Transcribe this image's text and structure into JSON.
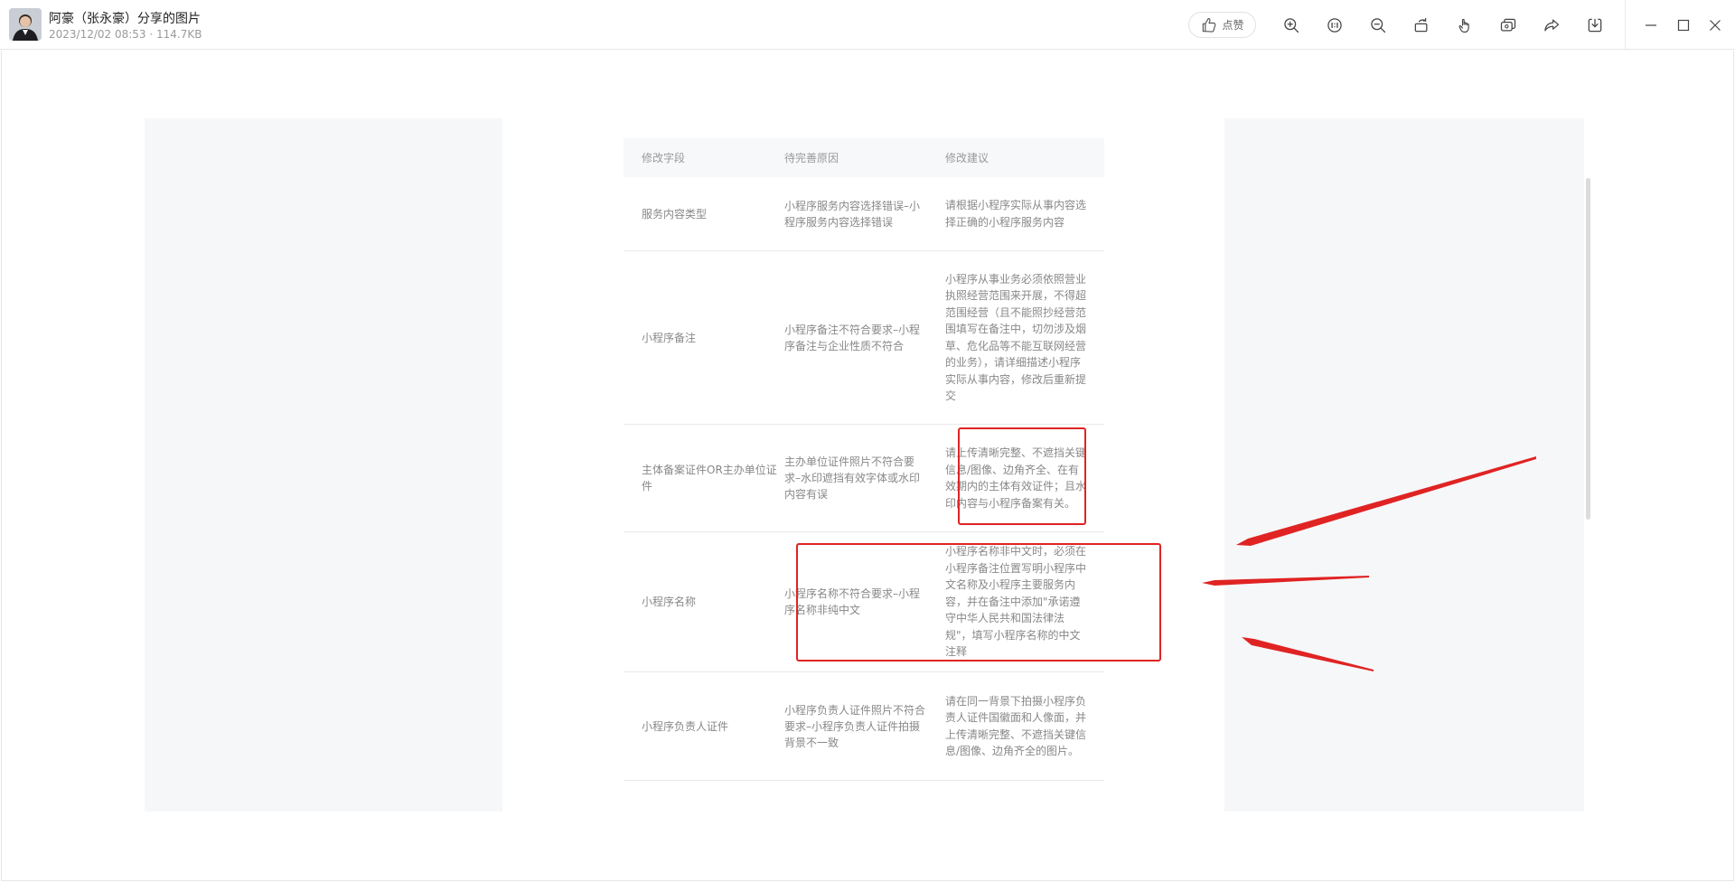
{
  "window": {
    "title": "阿豪（张永豪）分享的图片",
    "subtitle": "2023/12/02 08:53 · 114.7KB",
    "like_label": "点赞"
  },
  "toolbar": {
    "tools": [
      "zoom-in-icon",
      "actual-size-icon",
      "zoom-out-icon",
      "rotate-icon",
      "hand-icon",
      "copy-icon",
      "share-icon",
      "download-icon"
    ],
    "window_controls": [
      "minimize-icon",
      "maximize-icon",
      "close-icon"
    ]
  },
  "table": {
    "headers": [
      "修改字段",
      "待完善原因",
      "修改建议"
    ],
    "rows": [
      {
        "field": "服务内容类型",
        "reason": "小程序服务内容选择错误–小程序服务内容选择错误",
        "suggestion": "请根据小程序实际从事内容选择正确的小程序服务内容"
      },
      {
        "field": "小程序备注",
        "reason": "小程序备注不符合要求–小程序备注与企业性质不符合",
        "suggestion": "小程序从事业务必须依照营业执照经营范围来开展，不得超范围经营（且不能照抄经营范围填写在备注中，切勿涉及烟草、危化品等不能互联网经营的业务），请详细描述小程序实际从事内容，修改后重新提交"
      },
      {
        "field": "主体备案证件OR主办单位证件",
        "reason": "主办单位证件照片不符合要求–水印遮挡有效字体或水印内容有误",
        "suggestion": "请上传清晰完整、不遮挡关键信息/图像、边角齐全、在有效期内的主体有效证件；且水印内容与小程序备案有关。"
      },
      {
        "field": "小程序名称",
        "reason": "小程序名称不符合要求–小程序名称非纯中文",
        "suggestion": "小程序名称非中文时，必须在小程序备注位置写明小程序中文名称及小程序主要服务内容，并在备注中添加\"承诺遵守中华人民共和国法律法规\"，填写小程序名称的中文注释"
      },
      {
        "field": "小程序负责人证件",
        "reason": "小程序负责人证件照片不符合要求–小程序负责人证件拍摄背景不一致",
        "suggestion": "请在同一背景下拍摄小程序负责人证件国徽面和人像面，并上传清晰完整、不遮挡关键信息/图像、边角齐全的图片。"
      }
    ]
  },
  "colors": {
    "annotation_red": "#e02323",
    "panel_bg": "#f6f7f9"
  }
}
